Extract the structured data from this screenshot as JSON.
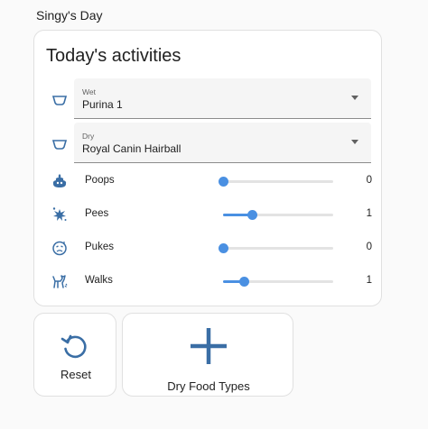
{
  "header": {
    "title": "Singy's Day"
  },
  "card": {
    "title": "Today's activities",
    "selects": [
      {
        "icon": "bowl-icon",
        "label": "Wet",
        "value": "Purina 1"
      },
      {
        "icon": "bowl-icon",
        "label": "Dry",
        "value": "Royal Canin Hairball"
      }
    ],
    "sliders": [
      {
        "icon": "poop-icon",
        "label": "Poops",
        "value": "0",
        "fraction": 0,
        "max": 10
      },
      {
        "icon": "pee-splash-icon",
        "label": "Pees",
        "value": "1",
        "fraction": 0.26,
        "max": 4
      },
      {
        "icon": "sick-face-icon",
        "label": "Pukes",
        "value": "0",
        "fraction": 0,
        "max": 10
      },
      {
        "icon": "walk-icon",
        "label": "Walks",
        "value": "1",
        "fraction": 0.19,
        "max": 5
      }
    ]
  },
  "buttons": {
    "reset": {
      "label": "Reset",
      "icon": "reset-icon"
    },
    "dry_food_types": {
      "label": "Dry Food Types",
      "icon": "plus-icon"
    }
  },
  "colors": {
    "accent": "#4a90e2",
    "icon": "#3a6ea5"
  }
}
